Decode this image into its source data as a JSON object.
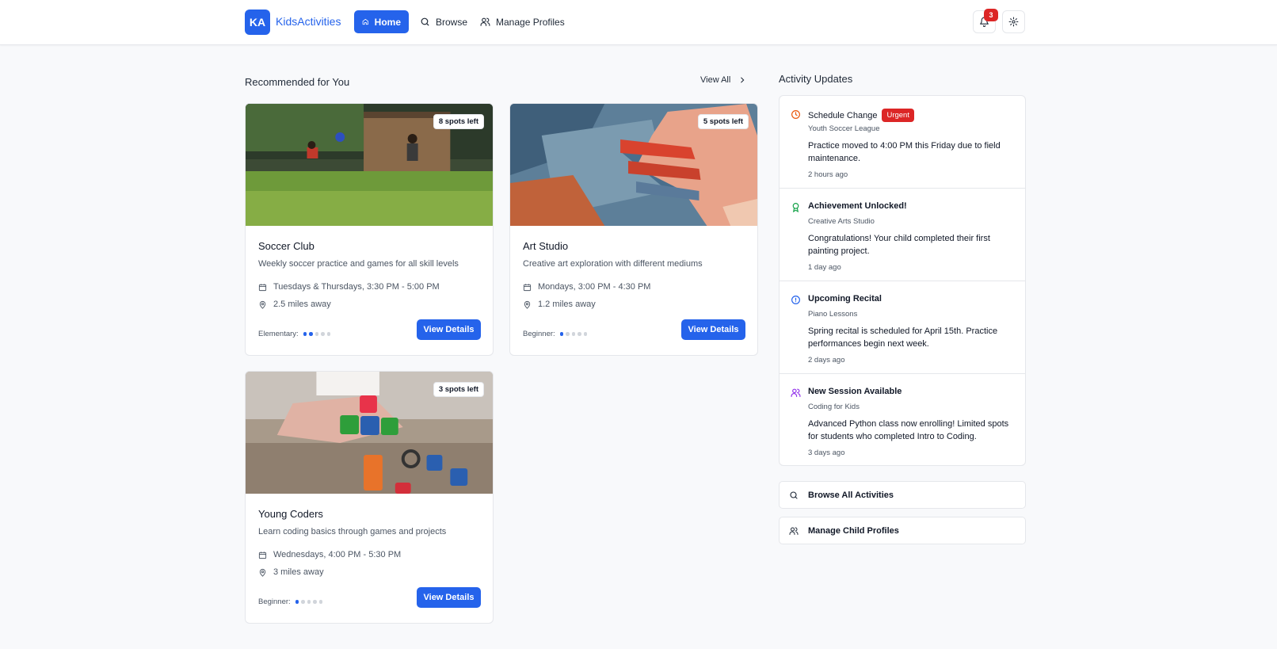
{
  "header": {
    "logo_initials": "KA",
    "logo_text": "KidsActivities",
    "nav": {
      "home": "Home",
      "browse": "Browse",
      "profiles": "Manage Profiles"
    },
    "notification_count": "3"
  },
  "recommended": {
    "title": "Recommended for You",
    "view_all": "View All",
    "cards": [
      {
        "spots": "8 spots left",
        "title": "Soccer Club",
        "desc": "Weekly soccer practice and games for all skill levels",
        "schedule": "Tuesdays & Thursdays, 3:30 PM - 5:00 PM",
        "distance": "2.5 miles away",
        "level_label": "Elementary:",
        "level": 2,
        "button": "View Details"
      },
      {
        "spots": "5 spots left",
        "title": "Art Studio",
        "desc": "Creative art exploration with different mediums",
        "schedule": "Mondays, 3:00 PM - 4:30 PM",
        "distance": "1.2 miles away",
        "level_label": "Beginner:",
        "level": 1,
        "button": "View Details"
      },
      {
        "spots": "3 spots left",
        "title": "Young Coders",
        "desc": "Learn coding basics through games and projects",
        "schedule": "Wednesdays, 4:00 PM - 5:30 PM",
        "distance": "3 miles away",
        "level_label": "Beginner:",
        "level": 1,
        "button": "View Details"
      }
    ]
  },
  "updates": {
    "title": "Activity Updates",
    "items": [
      {
        "title": "Schedule Change",
        "badge": "Urgent",
        "source": "Youth Soccer League",
        "message": "Practice moved to 4:00 PM this Friday due to field maintenance.",
        "time": "2 hours ago",
        "icon_color": "#ea580c"
      },
      {
        "title": "Achievement Unlocked!",
        "source": "Creative Arts Studio",
        "message": "Congratulations! Your child completed their first painting project.",
        "time": "1 day ago",
        "icon_color": "#16a34a"
      },
      {
        "title": "Upcoming Recital",
        "source": "Piano Lessons",
        "message": "Spring recital is scheduled for April 15th. Practice performances begin next week.",
        "time": "2 days ago",
        "icon_color": "#2563eb"
      },
      {
        "title": "New Session Available",
        "source": "Coding for Kids",
        "message": "Advanced Python class now enrolling! Limited spots for students who completed Intro to Coding.",
        "time": "3 days ago",
        "icon_color": "#9333ea"
      }
    ]
  },
  "quick_links": {
    "browse_all": "Browse All Activities",
    "manage_profiles": "Manage Child Profiles"
  },
  "colors": {
    "primary": "#2563eb",
    "urgent": "#dc2626"
  }
}
